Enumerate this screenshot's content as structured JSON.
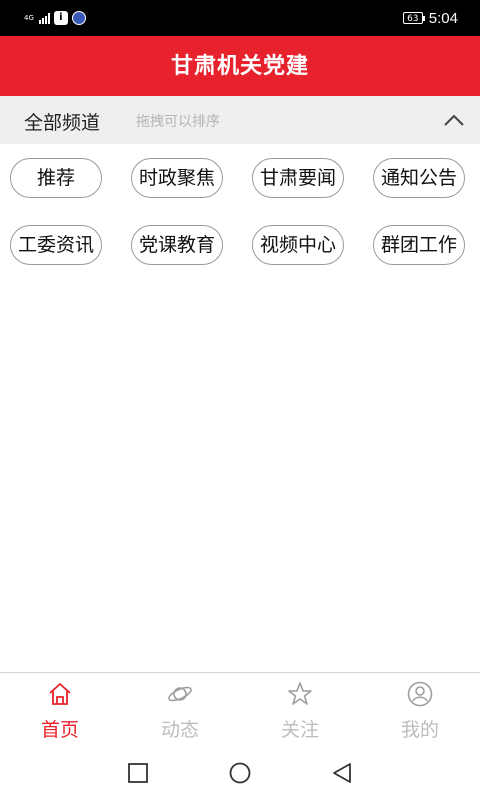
{
  "status_bar": {
    "network": "4G",
    "battery": "63",
    "time": "5:04",
    "app_icon_letter": "i"
  },
  "header": {
    "title": "甘肃机关党建"
  },
  "channels": {
    "title": "全部频道",
    "hint": "拖拽可以排序",
    "items": [
      "推荐",
      "时政聚焦",
      "甘肃要闻",
      "通知公告",
      "工委资讯",
      "党课教育",
      "视频中心",
      "群团工作"
    ]
  },
  "tabbar": {
    "items": [
      {
        "label": "首页",
        "icon": "home-icon",
        "active": true
      },
      {
        "label": "动态",
        "icon": "orbit-icon",
        "active": false
      },
      {
        "label": "关注",
        "icon": "star-icon",
        "active": false
      },
      {
        "label": "我的",
        "icon": "profile-icon",
        "active": false
      }
    ]
  },
  "colors": {
    "brand_red": "#e8222c",
    "inactive_gray": "#bdbdbd",
    "hint_gray": "#b5b5b5",
    "channel_bg": "#f0eeee"
  }
}
